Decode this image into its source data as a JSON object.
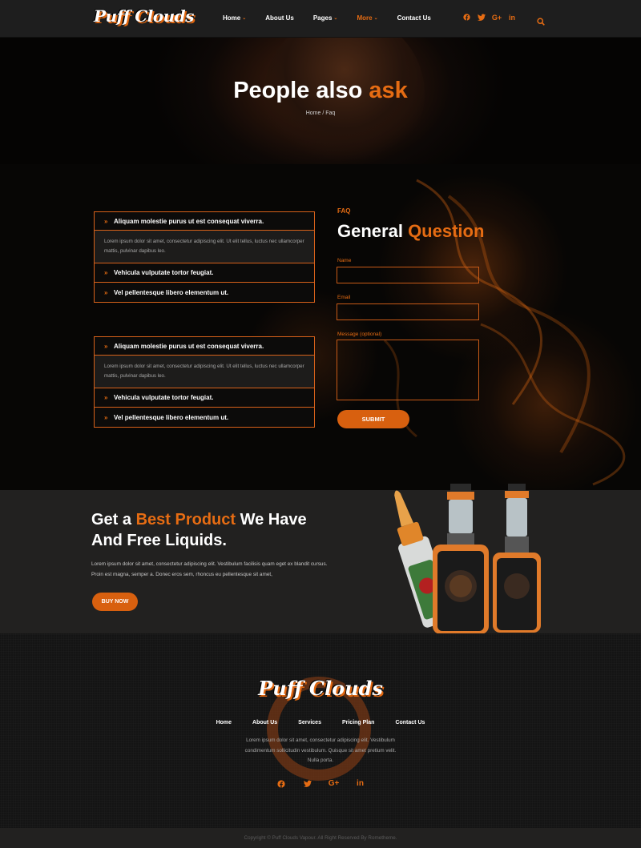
{
  "brand": {
    "logo_text": "Puff Clouds",
    "accent": "#e66c13"
  },
  "nav": {
    "items": [
      {
        "label": "Home",
        "has_dropdown": true,
        "active": false
      },
      {
        "label": "About Us",
        "has_dropdown": false,
        "active": false
      },
      {
        "label": "Pages",
        "has_dropdown": true,
        "active": false
      },
      {
        "label": "More",
        "has_dropdown": true,
        "active": true
      },
      {
        "label": "Contact Us",
        "has_dropdown": false,
        "active": false
      }
    ],
    "socials": [
      "facebook-icon",
      "twitter-icon",
      "google-plus-icon",
      "linkedin-icon"
    ],
    "search_icon": "search-icon"
  },
  "hero": {
    "title_main": "People also",
    "title_accent": "ask",
    "breadcrumb_home": "Home",
    "breadcrumb_sep": " / ",
    "breadcrumb_current": "Faq"
  },
  "faq": {
    "accordions": [
      {
        "open_question": "Aliquam molestie purus ut est consequat viverra.",
        "open_answer": "Lorem ipsum dolor sit amet, consectetur adipiscing elit. Ut elit tellus, luctus nec ullamcorper mattis, pulvinar dapibus leo.",
        "collapsed": [
          "Vehicula vulputate tortor feugiat.",
          "Vel pellentesque libero elementum ut."
        ]
      },
      {
        "open_question": "Aliquam molestie purus ut est consequat viverra.",
        "open_answer": "Lorem ipsum dolor sit amet, consectetur adipiscing elit. Ut elit tellus, luctus nec ullamcorper mattis, pulvinar dapibus leo.",
        "collapsed": [
          "Vehicula vulputate tortor feugiat.",
          "Vel pellentesque libero elementum ut."
        ]
      }
    ]
  },
  "form": {
    "kicker": "FAQ",
    "title_main": "General",
    "title_accent": "Question",
    "name_label": "Name",
    "name_value": "",
    "email_label": "Email",
    "email_value": "",
    "message_label": "Message (optional)",
    "message_value": "",
    "submit_label": "SUBMIT"
  },
  "banner": {
    "title_1": "Get a ",
    "title_accent": "Best Product",
    "title_2": " We Have",
    "title_3": "And Free Liquids.",
    "text": "Lorem ipsum dolor sit amet, consectetur adipiscing elit. Vestibulum facilisis quam eget ex blandit cursus. Proin est magna, semper a. Donec eros sem, rhoncus eu pellentesque sit amet,",
    "button_label": "BUY NOW"
  },
  "footer": {
    "logo_text": "Puff Clouds",
    "links": [
      "Home",
      "About Us",
      "Services",
      "Pricing Plan",
      "Contact Us"
    ],
    "text": "Lorem ipsum dolor sit amet, consectetur adipiscing elit. Vestibulum condimentum sollicitudin vestibulum. Quisque sit amet pretium velit. Nulla porta.",
    "socials": [
      "facebook-icon",
      "twitter-icon",
      "google-plus-icon",
      "linkedin-icon"
    ],
    "copyright": "Copyright © Puff Clouds Vapour. All Right Reserved By Rometheme."
  }
}
